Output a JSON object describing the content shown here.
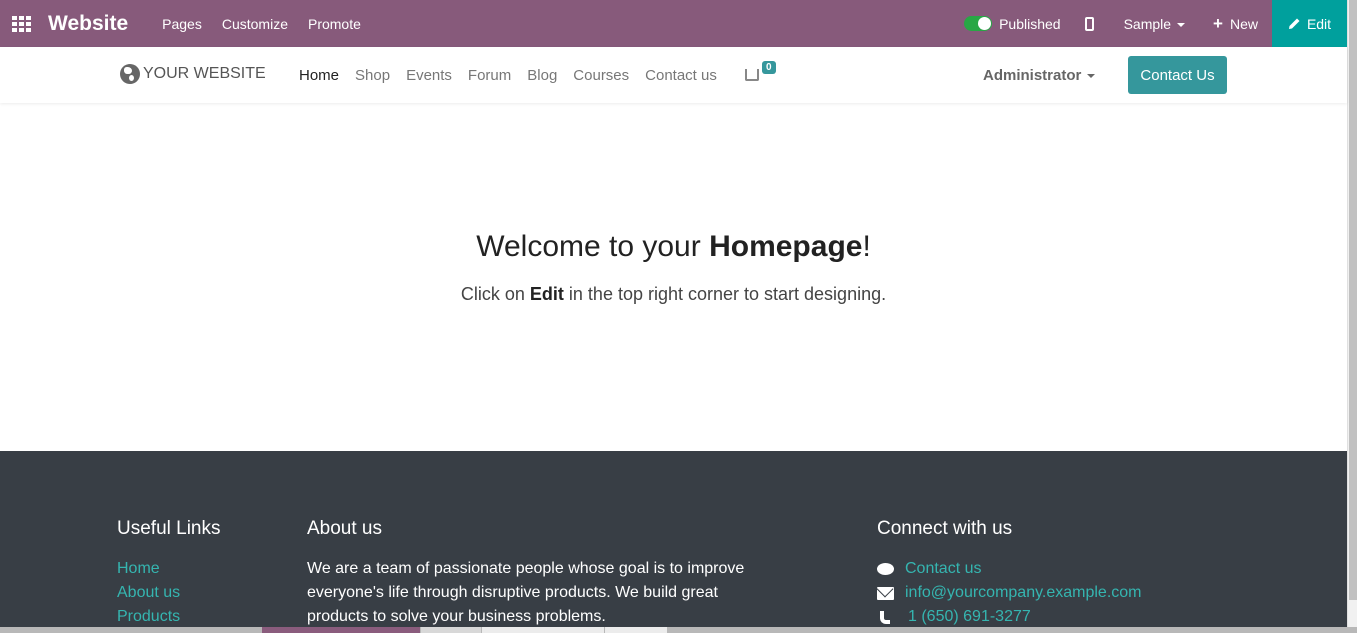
{
  "topbar": {
    "brand": "Website",
    "menu": [
      "Pages",
      "Customize",
      "Promote"
    ],
    "published_label": "Published",
    "sample_label": "Sample",
    "new_label": "New",
    "edit_label": "Edit",
    "color": "#875a7b",
    "edit_color": "#00a09d"
  },
  "site_header": {
    "logo_text": "YOUR WEBSITE",
    "nav": [
      "Home",
      "Shop",
      "Events",
      "Forum",
      "Blog",
      "Courses",
      "Contact us"
    ],
    "cart_count": "0",
    "user": "Administrator",
    "contact_button": "Contact Us",
    "accent": "#35979c"
  },
  "hero": {
    "title_prefix": "Welcome to your ",
    "title_bold": "Homepage",
    "title_suffix": "!",
    "sub_prefix": "Click on ",
    "sub_bold": "Edit",
    "sub_suffix": " in the top right corner to start designing."
  },
  "footer": {
    "useful_links_title": "Useful Links",
    "useful_links": [
      "Home",
      "About us",
      "Products"
    ],
    "about_title": "About us",
    "about_text": "We are a team of passionate people whose goal is to improve everyone's life through disruptive products. We build great products to solve your business problems.",
    "connect_title": "Connect with us",
    "contacts": {
      "contact": "Contact us",
      "email": "info@yourcompany.example.com",
      "phone": "1 (650) 691-3277"
    },
    "background": "#383e45",
    "link_color": "#35b5b0"
  }
}
